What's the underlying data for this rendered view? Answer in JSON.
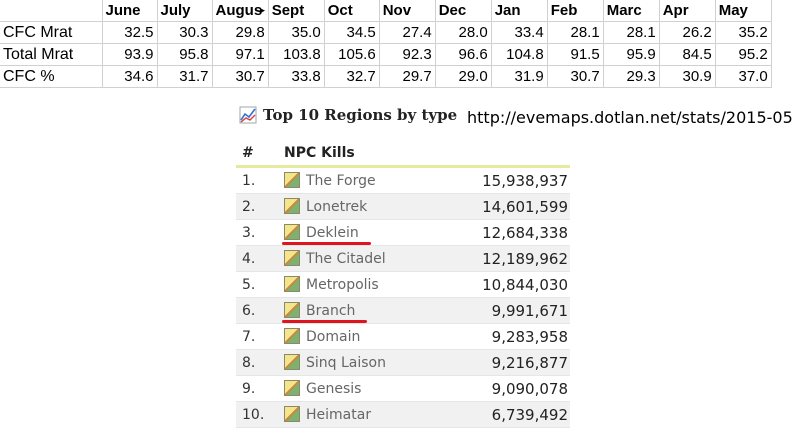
{
  "sheet": {
    "months": [
      "June",
      "July",
      "Augus",
      "Sept",
      "Oct",
      "Nov",
      "Dec",
      "Jan",
      "Feb",
      "Marc",
      "Apr",
      "May"
    ],
    "rows": [
      {
        "label": "CFC Mrat",
        "values": [
          "32.5",
          "30.3",
          "29.8",
          "35.0",
          "34.5",
          "27.4",
          "28.0",
          "33.4",
          "28.1",
          "28.1",
          "26.2",
          "35.2"
        ]
      },
      {
        "label": "Total Mrat",
        "values": [
          "93.9",
          "95.8",
          "97.1",
          "103.8",
          "105.6",
          "92.3",
          "96.6",
          "104.8",
          "91.5",
          "95.9",
          "84.5",
          "95.2"
        ]
      },
      {
        "label": "CFC %",
        "values": [
          "34.6",
          "31.7",
          "30.7",
          "33.8",
          "32.7",
          "29.7",
          "29.0",
          "31.9",
          "30.7",
          "29.3",
          "30.9",
          "37.0"
        ]
      }
    ]
  },
  "section": {
    "title": "Top 10 Regions by type",
    "icon": "chart-icon",
    "url": "http://evemaps.dotlan.net/stats/2015-05"
  },
  "regions": {
    "headers": {
      "rank": "#",
      "kills": "NPC Kills"
    },
    "rows": [
      {
        "rank": "1.",
        "name": "The Forge",
        "kills": "15,938,937"
      },
      {
        "rank": "2.",
        "name": "Lonetrek",
        "kills": "14,601,599"
      },
      {
        "rank": "3.",
        "name": "Deklein",
        "kills": "12,684,338",
        "underline": true
      },
      {
        "rank": "4.",
        "name": "The Citadel",
        "kills": "12,189,962"
      },
      {
        "rank": "5.",
        "name": "Metropolis",
        "kills": "10,844,030"
      },
      {
        "rank": "6.",
        "name": "Branch",
        "kills": "9,991,671",
        "underline": true
      },
      {
        "rank": "7.",
        "name": "Domain",
        "kills": "9,283,958"
      },
      {
        "rank": "8.",
        "name": "Sinq Laison",
        "kills": "9,216,877"
      },
      {
        "rank": "9.",
        "name": "Genesis",
        "kills": "9,090,078"
      },
      {
        "rank": "10.",
        "name": "Heimatar",
        "kills": "6,739,492"
      }
    ],
    "annotation_color": "#e0141e"
  }
}
